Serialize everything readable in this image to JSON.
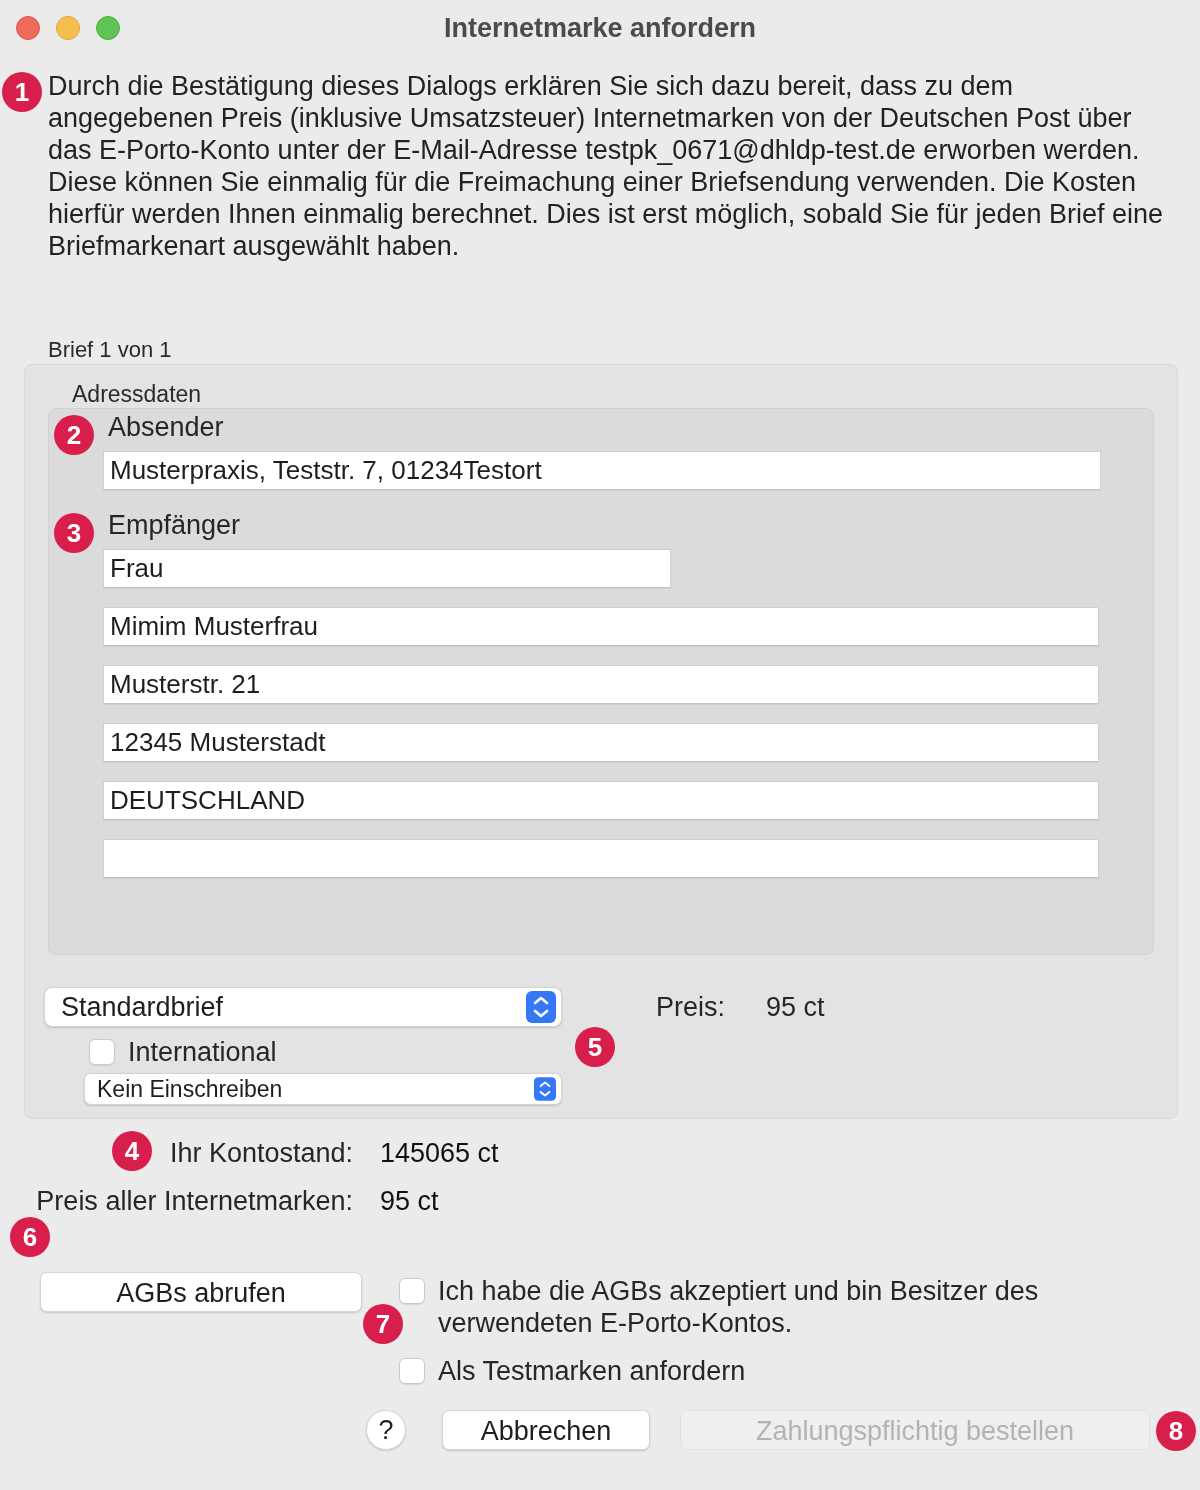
{
  "window": {
    "title": "Internetmarke anfordern"
  },
  "description": "Durch die Bestätigung dieses Dialogs erklären Sie sich dazu bereit, dass zu dem angegebenen Preis (inklusive Umsatzsteuer) Internetmarken von der Deutschen Post über das E-Porto-Konto unter der E-Mail-Adresse testpk_0671@dhldp-test.de erworben werden. Diese können Sie einmalig für die Freimachung einer Briefsendung verwenden. Die Kosten hierfür werden Ihnen einmalig berechnet. Dies ist erst möglich, sobald Sie für jeden Brief eine Briefmarkenart ausgewählt haben.",
  "letter_counter": "Brief 1 von 1",
  "address_group": {
    "title": "Adressdaten",
    "sender": {
      "label": "Absender",
      "value": "Musterpraxis, Teststr. 7, 01234Testort"
    },
    "recipient": {
      "label": "Empfänger",
      "lines": [
        {
          "kind": "short",
          "value": "Frau"
        },
        {
          "kind": "long",
          "value": "Mimim Musterfrau"
        },
        {
          "kind": "long",
          "value": "Musterstr. 21"
        },
        {
          "kind": "long",
          "value": "12345 Musterstadt"
        },
        {
          "kind": "long",
          "value": "DEUTSCHLAND"
        },
        {
          "kind": "long"
        }
      ]
    }
  },
  "product_select": {
    "value": "Standardbrief"
  },
  "international": {
    "label": "International",
    "checked": false
  },
  "registration_select": {
    "value": "Kein Einschreiben"
  },
  "price": {
    "label": "Preis:",
    "value": "95 ct"
  },
  "balance": {
    "label": "Ihr Kontostand:",
    "value": "145065 ct"
  },
  "total": {
    "label": "Preis aller Internetmarken:",
    "value": "95 ct"
  },
  "terms_button": "AGBs abrufen",
  "checkboxes": [
    {
      "label": "Ich habe die AGBs akzeptiert und bin Besitzer des verwendeten E-Porto-Kontos.",
      "checked": false
    },
    {
      "label": "Als Testmarken anfordern",
      "checked": false
    }
  ],
  "help_button": "?",
  "buttons": [
    {
      "label": "Abbrechen",
      "disabled": false
    },
    {
      "label": "Zahlungspflichtig bestellen",
      "disabled": true
    }
  ],
  "callouts": [
    "1",
    "2",
    "3",
    "4",
    "5",
    "6",
    "7",
    "8"
  ]
}
